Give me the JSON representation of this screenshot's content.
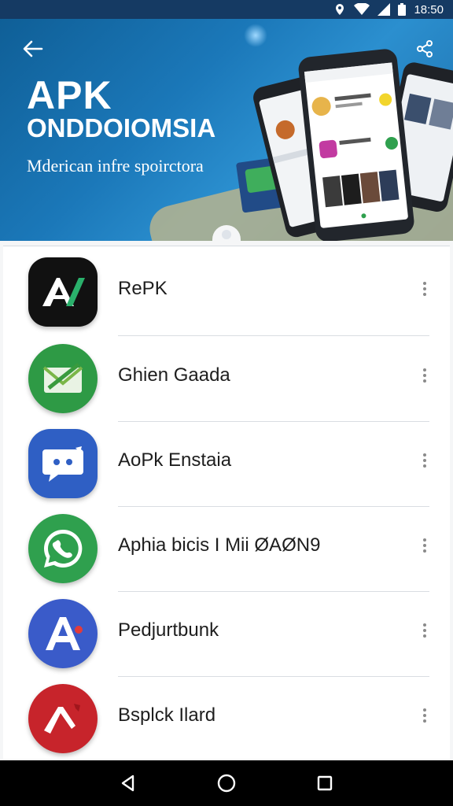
{
  "status_bar": {
    "time": "18:50",
    "icons": [
      "location-icon",
      "wifi-icon",
      "signal-icon",
      "battery-icon"
    ]
  },
  "hero": {
    "title": "APK",
    "subtitle": "ONDDOIOMSIA",
    "tagline": "Mderican infre spoirctora",
    "back_icon": "arrow-back-icon",
    "share_icon": "share-icon",
    "colors": {
      "top": "#0f5f97",
      "bottom": "#2b8fcf"
    }
  },
  "apps": [
    {
      "name": "RePK",
      "icon": "apk-logo-icon",
      "color": "#111111"
    },
    {
      "name": "Ghien Gaada",
      "icon": "mail-envelope-icon",
      "color": "#2e9a45"
    },
    {
      "name": "AoPk Enstaia",
      "icon": "chat-bubble-icon",
      "color": "#2f5fc4"
    },
    {
      "name": "Aphia bicis I Mii ØAØN9",
      "icon": "phone-call-icon",
      "color": "#2fa04e"
    },
    {
      "name": "Pedjurtbunk",
      "icon": "letter-a-icon",
      "color": "#3a5bc9"
    },
    {
      "name": "Bsplck Ilard",
      "icon": "letter-a-red-icon",
      "color": "#c7242b"
    }
  ],
  "nav": {
    "back_icon": "nav-back-icon",
    "home_icon": "nav-home-icon",
    "recents_icon": "nav-recents-icon"
  }
}
